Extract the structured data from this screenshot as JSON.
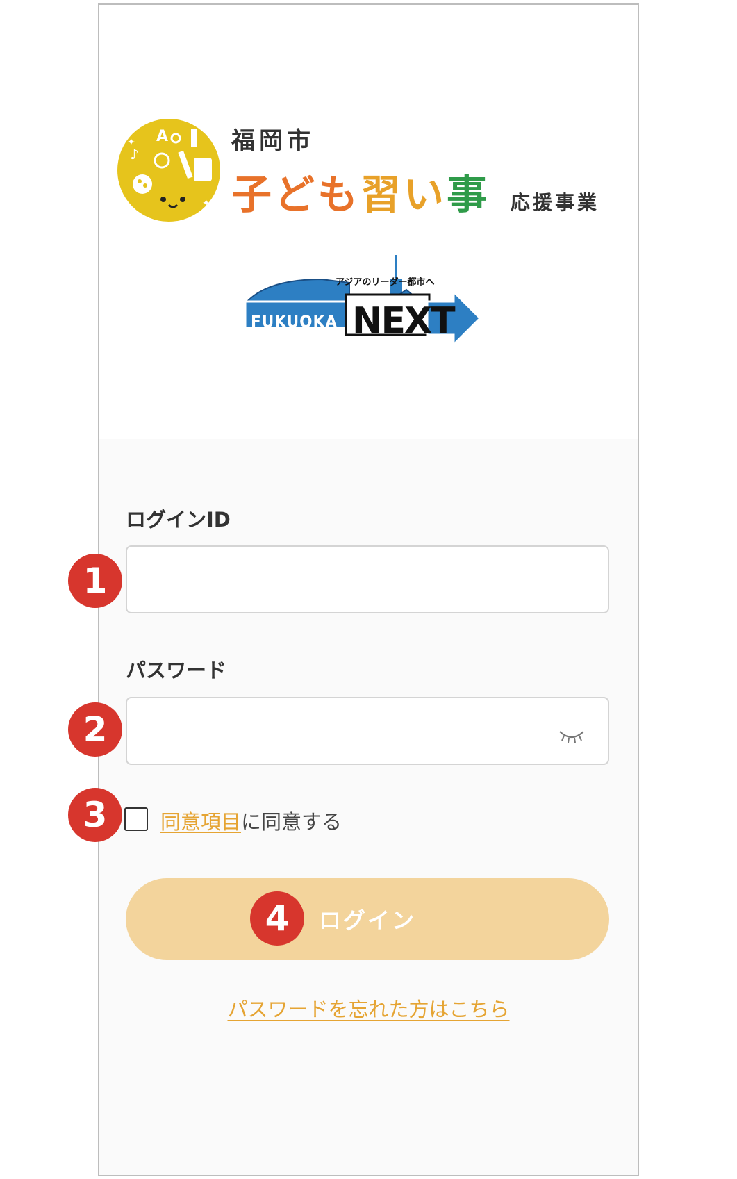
{
  "branding": {
    "city_name": "福岡市",
    "program_title": {
      "part1": "子ども",
      "part2": "習い",
      "part3": "事"
    },
    "program_suffix": "応援事業",
    "next_tagline": "アジアのリーダー都市へ",
    "next_fukuoka": "FUKUOKA",
    "next_word": "NEXT"
  },
  "form": {
    "login_id_label": "ログインID",
    "login_id_value": "",
    "password_label": "パスワード",
    "password_value": "",
    "agree_link": "同意項目",
    "agree_suffix": "に同意する",
    "agree_checked": false,
    "login_button": "ログイン",
    "forgot_link": "パスワードを忘れた方はこちら"
  },
  "badges": {
    "b1": "1",
    "b2": "2",
    "b3": "3",
    "b4": "4"
  },
  "icons": {
    "password_toggle": "eye-closed-icon",
    "logo": "kids-lessons-logo-icon"
  },
  "colors": {
    "accent": "#e5a433",
    "login_button_bg": "#f3d49c",
    "badge": "#d7362d",
    "logo_yellow": "#e6c41c"
  }
}
